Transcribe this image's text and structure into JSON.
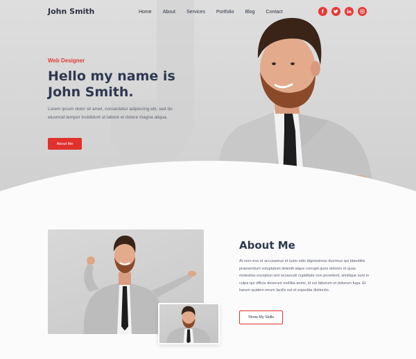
{
  "nav": {
    "brand": "John Smith",
    "items": [
      "Home",
      "About",
      "Services",
      "Portfolio",
      "Blog",
      "Contact"
    ],
    "social": [
      {
        "icon": "facebook-icon"
      },
      {
        "icon": "twitter-icon"
      },
      {
        "icon": "linkedin-icon"
      },
      {
        "icon": "instagram-icon"
      }
    ]
  },
  "hero": {
    "kicker": "Web Designer",
    "headline": "Hello my name is John Smith.",
    "lead": "Lorem ipsum dolor sit amet, consectetur adipiscing elit, sed do eiusmod tempor incididunt ut labore et dolore magna aliqua.",
    "button": "About Me"
  },
  "about": {
    "title": "About Me",
    "text": "At vero eos et accusamus et iusto odio dignissimos ducimus qui blanditiis praesentium voluptatum deleniti atque corrupti quos dolores et quas molestias excepturi sint occaecati cupiditate non provident, similique sunt in culpa qui officia deserunt mollitia animi, id est laborum et dolorum fuga. Et harum quidem rerum facilis est et expedita distinctio.",
    "button": "Show My Skills"
  },
  "colors": {
    "accent": "#e0312c",
    "heading": "#2e3850"
  }
}
